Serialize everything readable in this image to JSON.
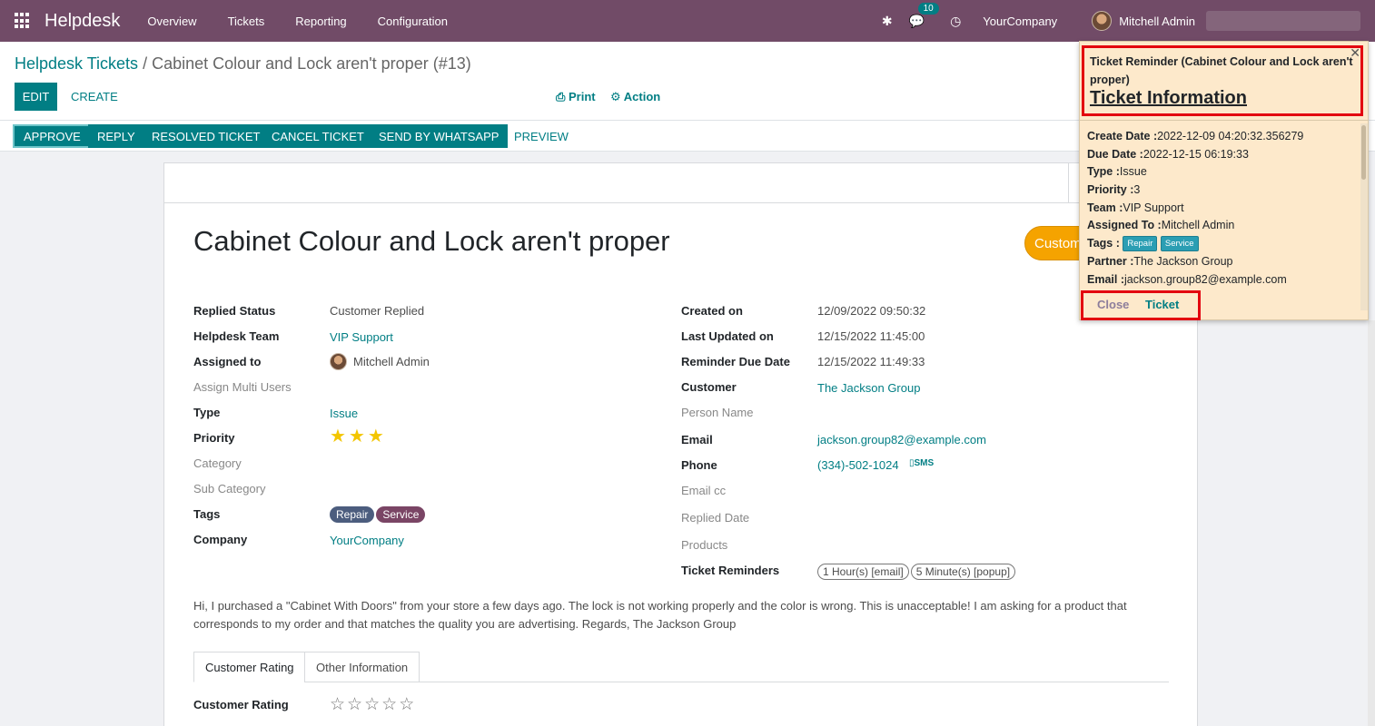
{
  "navbar": {
    "brand": "Helpdesk",
    "menu": [
      "Overview",
      "Tickets",
      "Reporting",
      "Configuration"
    ],
    "chat_count": "10",
    "company": "YourCompany",
    "user": "Mitchell Admin"
  },
  "control_panel": {
    "breadcrumb_parent": "Helpdesk Tickets",
    "breadcrumb_sep": " / ",
    "breadcrumb_current": "Cabinet Colour and Lock aren't proper (#13)",
    "edit_label": "EDIT",
    "create_label": "CREATE",
    "print_label": "Print",
    "action_label": "Action"
  },
  "statusbar": {
    "approve": "APPROVE",
    "reply": "REPLY",
    "resolved": "RESOLVED TICKET",
    "cancel": "CANCEL TICKET",
    "whatsapp": "SEND BY WHATSAPP",
    "preview": "PREVIEW"
  },
  "ticket": {
    "title": "Cabinet Colour and Lock aren't proper",
    "stage": "Customer Replied",
    "left_fields": {
      "replied_status_label": "Replied Status",
      "replied_status": "Customer Replied",
      "team_label": "Helpdesk Team",
      "team": "VIP Support",
      "assigned_label": "Assigned to",
      "assigned": "Mitchell Admin",
      "multi_users_label": "Assign Multi Users",
      "type_label": "Type",
      "type": "Issue",
      "priority_label": "Priority",
      "priority": 3,
      "category_label": "Category",
      "subcategory_label": "Sub Category",
      "tags_label": "Tags",
      "tags": [
        "Repair",
        "Service"
      ],
      "company_label": "Company",
      "company": "YourCompany"
    },
    "right_fields": {
      "created_label": "Created on",
      "created": "12/09/2022 09:50:32",
      "updated_label": "Last Updated on",
      "updated": "12/15/2022 11:45:00",
      "reminder_due_label": "Reminder Due Date",
      "reminder_due": "12/15/2022 11:49:33",
      "customer_label": "Customer",
      "customer": "The Jackson Group",
      "person_label": "Person Name",
      "email_label": "Email",
      "email": "jackson.group82@example.com",
      "phone_label": "Phone",
      "phone": "(334)-502-1024",
      "sms": "SMS",
      "emailcc_label": "Email cc",
      "replied_date_label": "Replied Date",
      "products_label": "Products",
      "reminders_label": "Ticket Reminders",
      "reminders": [
        "1 Hour(s) [email]",
        "5 Minute(s) [popup]"
      ]
    },
    "description": "Hi, I purchased a \"Cabinet With Doors\" from your store a few days ago. The lock is not working properly and the color is wrong. This is unacceptable! I am asking for a product that corresponds to my order and that matches the quality you are advertising. Regards, The Jackson Group",
    "tabs": [
      "Customer Rating",
      "Other Information"
    ],
    "customer_rating_label": "Customer Rating",
    "customer_rating": 0
  },
  "popup": {
    "title": "Ticket Reminder (Cabinet Colour and Lock aren't proper)",
    "info_heading": "Ticket Information",
    "rows": {
      "create_date_label": "Create Date :",
      "create_date": "2022-12-09 04:20:32.356279",
      "due_date_label": "Due Date :",
      "due_date": "2022-12-15 06:19:33",
      "type_label": "Type :",
      "type": "Issue",
      "priority_label": "Priority :",
      "priority": "3",
      "team_label": "Team :",
      "team": "VIP Support",
      "assigned_label": "Assigned To :",
      "assigned": "Mitchell Admin",
      "tags_label": "Tags :",
      "tags": [
        "Repair",
        "Service"
      ],
      "partner_label": "Partner :",
      "partner": "The Jackson Group",
      "email_label": "Email :",
      "email": "jackson.group82@example.com"
    },
    "close_label": "Close",
    "ticket_label": "Ticket"
  },
  "colors": {
    "navbar": "#714b67",
    "primary": "#017e84",
    "stage": "#f5a300",
    "highlight": "#e3000f",
    "popup_bg": "#fde9cb"
  }
}
